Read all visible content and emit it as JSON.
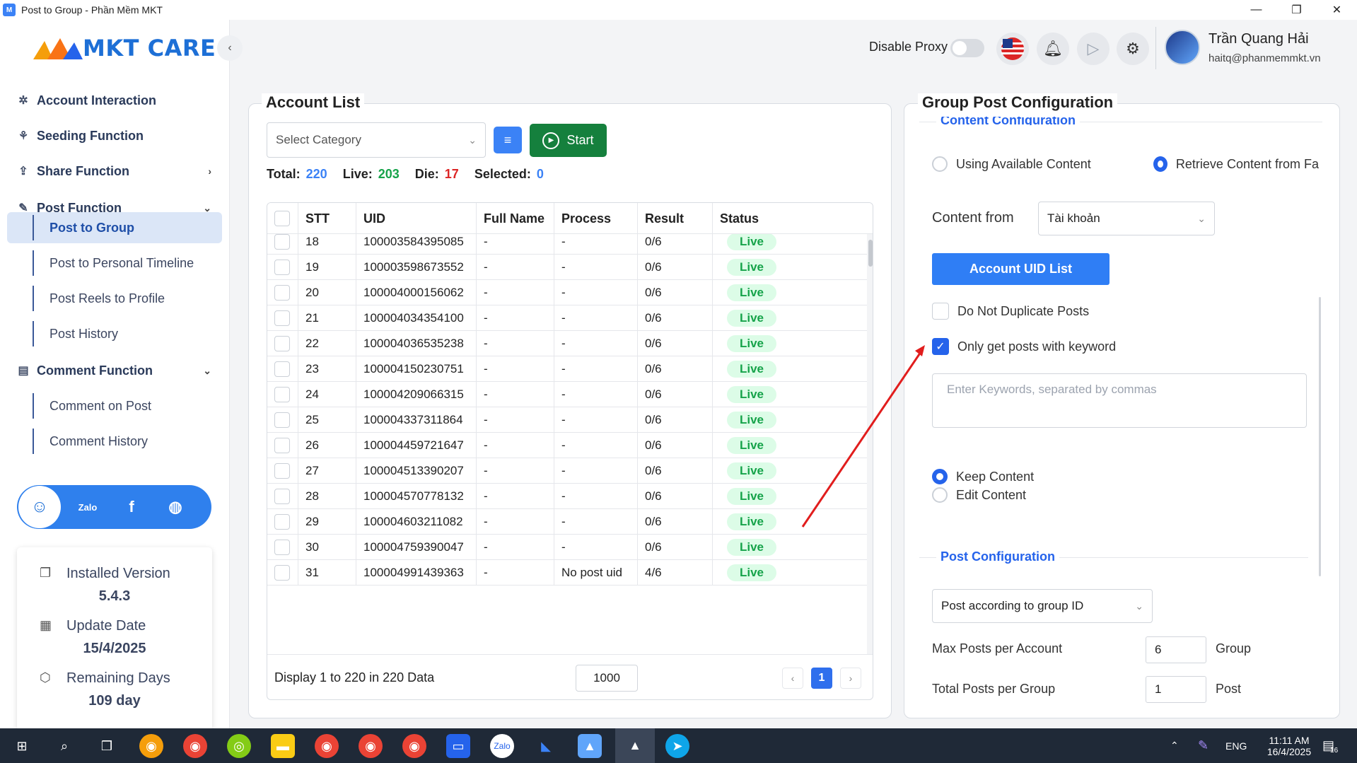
{
  "window": {
    "title": "Post to Group - Phần Mềm MKT"
  },
  "logo": {
    "text": "MKT CARE"
  },
  "sidebar": {
    "items": [
      {
        "label": "Account Interaction",
        "icon": "interaction-icon"
      },
      {
        "label": "Seeding Function",
        "icon": "seeding-icon"
      },
      {
        "label": "Share Function",
        "icon": "share-icon"
      },
      {
        "label": "Post Function",
        "icon": "post-icon"
      }
    ],
    "post_sub": [
      "Post to Group",
      "Post to Personal Timeline",
      "Post Reels to Profile",
      "Post History"
    ],
    "comment": {
      "label": "Comment Function",
      "icon": "comment-icon"
    },
    "comment_sub": [
      "Comment on Post",
      "Comment History"
    ],
    "info": {
      "version_label": "Installed Version",
      "version": "5.4.3",
      "update_label": "Update Date",
      "update": "15/4/2025",
      "remaining_label": "Remaining Days",
      "remaining": "109 day"
    }
  },
  "header": {
    "proxy_label": "Disable Proxy",
    "user_name": "Trần Quang Hải",
    "user_email": "haitq@phanmemmkt.vn"
  },
  "account_list": {
    "title": "Account List",
    "category_placeholder": "Select Category",
    "start_label": "Start",
    "stats": {
      "total_label": "Total:",
      "total": "220",
      "live_label": "Live:",
      "live": "203",
      "die_label": "Die:",
      "die": "17",
      "selected_label": "Selected:",
      "selected": "0"
    },
    "columns": [
      "STT",
      "UID",
      "Full Name",
      "Process",
      "Result",
      "Status"
    ],
    "rows": [
      {
        "stt": "18",
        "uid": "100003584395085",
        "name": "-",
        "process": "-",
        "result": "0/6",
        "status": "Live"
      },
      {
        "stt": "19",
        "uid": "100003598673552",
        "name": "-",
        "process": "-",
        "result": "0/6",
        "status": "Live"
      },
      {
        "stt": "20",
        "uid": "100004000156062",
        "name": "-",
        "process": "-",
        "result": "0/6",
        "status": "Live"
      },
      {
        "stt": "21",
        "uid": "100004034354100",
        "name": "-",
        "process": "-",
        "result": "0/6",
        "status": "Live"
      },
      {
        "stt": "22",
        "uid": "100004036535238",
        "name": "-",
        "process": "-",
        "result": "0/6",
        "status": "Live"
      },
      {
        "stt": "23",
        "uid": "100004150230751",
        "name": "-",
        "process": "-",
        "result": "0/6",
        "status": "Live"
      },
      {
        "stt": "24",
        "uid": "100004209066315",
        "name": "-",
        "process": "-",
        "result": "0/6",
        "status": "Live"
      },
      {
        "stt": "25",
        "uid": "100004337311864",
        "name": "-",
        "process": "-",
        "result": "0/6",
        "status": "Live"
      },
      {
        "stt": "26",
        "uid": "100004459721647",
        "name": "-",
        "process": "-",
        "result": "0/6",
        "status": "Live"
      },
      {
        "stt": "27",
        "uid": "100004513390207",
        "name": "-",
        "process": "-",
        "result": "0/6",
        "status": "Live"
      },
      {
        "stt": "28",
        "uid": "100004570778132",
        "name": "-",
        "process": "-",
        "result": "0/6",
        "status": "Live"
      },
      {
        "stt": "29",
        "uid": "100004603211082",
        "name": "-",
        "process": "-",
        "result": "0/6",
        "status": "Live"
      },
      {
        "stt": "30",
        "uid": "100004759390047",
        "name": "-",
        "process": "-",
        "result": "0/6",
        "status": "Live"
      },
      {
        "stt": "31",
        "uid": "100004991439363",
        "name": "-",
        "process": "No post uid",
        "result": "4/6",
        "status": "Live"
      }
    ],
    "footer_text": "Display 1 to 220 in 220 Data",
    "page_size": "1000",
    "current_page": "1"
  },
  "config": {
    "title": "Group Post Configuration",
    "content_section": "Content Configuration",
    "radio_available": "Using Available Content",
    "radio_retrieve": "Retrieve Content from Fa",
    "content_from_label": "Content from",
    "content_from_value": "Tài khoản",
    "uid_button": "Account UID List",
    "no_duplicate": "Do Not Duplicate Posts",
    "keyword_only": "Only get posts with keyword",
    "keyword_placeholder": "Enter Keywords, separated by commas",
    "keep_content": "Keep Content",
    "edit_content": "Edit Content",
    "post_section": "Post Configuration",
    "post_mode": "Post according to group ID",
    "max_posts_label": "Max Posts per Account",
    "max_posts_value": "6",
    "max_posts_unit": "Group",
    "total_posts_label": "Total Posts per Group",
    "total_posts_value": "1",
    "total_posts_unit": "Post"
  },
  "taskbar": {
    "lang": "ENG",
    "time": "11:11 AM",
    "date": "16/4/2025",
    "notif_count": "16"
  },
  "colors": {
    "accent": "#2563eb",
    "start": "#15803d",
    "live": "#16a34a",
    "die": "#dc2626"
  }
}
